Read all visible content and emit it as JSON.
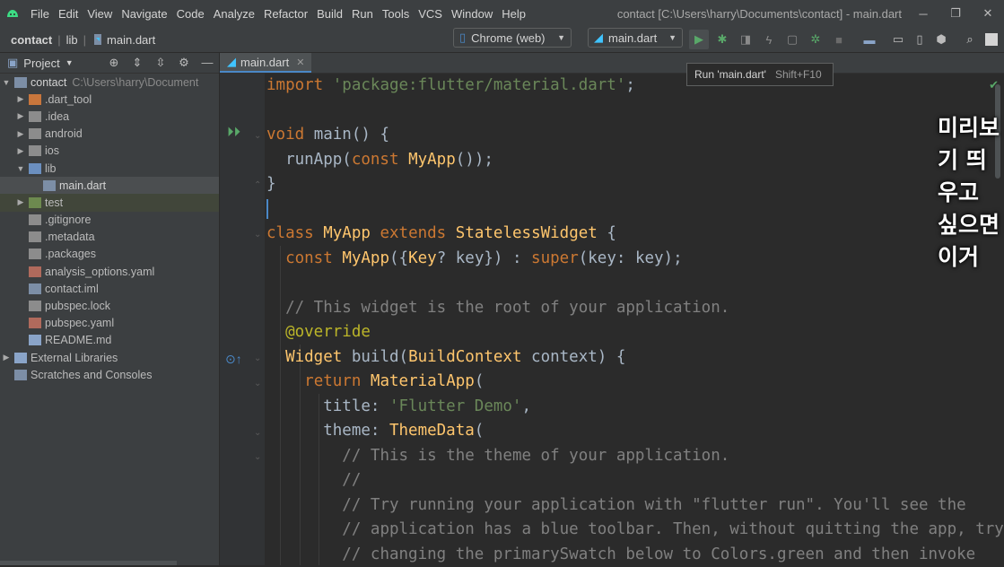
{
  "menubar": {
    "items": [
      "File",
      "Edit",
      "View",
      "Navigate",
      "Code",
      "Analyze",
      "Refactor",
      "Build",
      "Run",
      "Tools",
      "VCS",
      "Window",
      "Help"
    ],
    "window_title": "contact [C:\\Users\\harry\\Documents\\contact] - main.dart"
  },
  "navbar": {
    "crumbs": [
      "contact",
      "lib",
      "main.dart"
    ],
    "device": "Chrome (web)",
    "config": "main.dart"
  },
  "tooltip": {
    "text": "Run 'main.dart'",
    "shortcut": "Shift+F10"
  },
  "project": {
    "header": "Project",
    "rows": [
      {
        "label": "contact",
        "path": "C:\\Users\\harry\\Document"
      },
      {
        "label": ".dart_tool"
      },
      {
        "label": ".idea"
      },
      {
        "label": "android"
      },
      {
        "label": "ios"
      },
      {
        "label": "lib"
      },
      {
        "label": "main.dart"
      },
      {
        "label": "test"
      },
      {
        "label": ".gitignore"
      },
      {
        "label": ".metadata"
      },
      {
        "label": ".packages"
      },
      {
        "label": "analysis_options.yaml"
      },
      {
        "label": "contact.iml"
      },
      {
        "label": "pubspec.lock"
      },
      {
        "label": "pubspec.yaml"
      },
      {
        "label": "README.md"
      },
      {
        "label": "External Libraries"
      },
      {
        "label": "Scratches and Consoles"
      }
    ]
  },
  "editor": {
    "tab": "main.dart",
    "subtitle": "미리보기 띄우고 싶으면 이거",
    "lines": [
      "import 'package:flutter/material.dart';",
      "",
      "void main() {",
      "  runApp(const MyApp());",
      "}",
      "",
      "class MyApp extends StatelessWidget {",
      "  const MyApp({Key? key}) : super(key: key);",
      "",
      "  // This widget is the root of your application.",
      "  @override",
      "  Widget build(BuildContext context) {",
      "    return MaterialApp(",
      "      title: 'Flutter Demo',",
      "      theme: ThemeData(",
      "        // This is the theme of your application.",
      "        //",
      "        // Try running your application with \"flutter run\". You'll see the",
      "        // application has a blue toolbar. Then, without quitting the app, try",
      "        // changing the primarySwatch below to Colors.green and then invoke"
    ]
  },
  "colors": {
    "keyword": "#cc7832",
    "string": "#6a8759",
    "class": "#ffc66d",
    "comment": "#808080",
    "annotation": "#bbb529",
    "run_green": "#59a869",
    "accent": "#4a88c7"
  }
}
